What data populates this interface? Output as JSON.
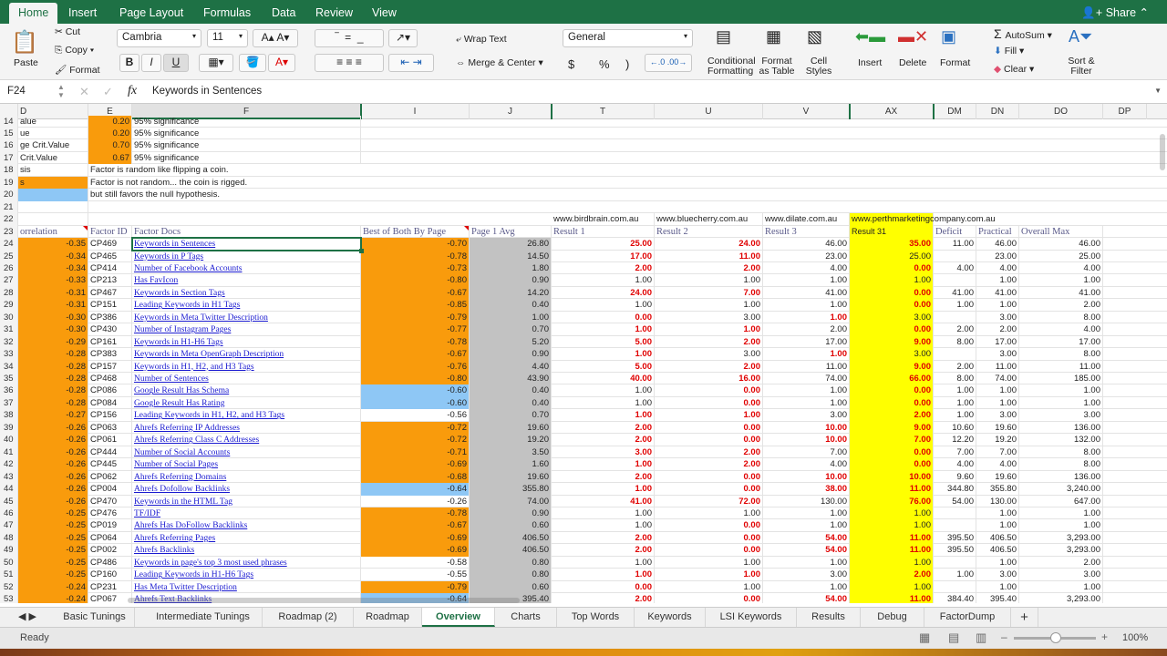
{
  "ribbon_tabs": [
    "Home",
    "Insert",
    "Page Layout",
    "Formulas",
    "Data",
    "Review",
    "View"
  ],
  "share_label": "Share",
  "ribbon": {
    "paste": "Paste",
    "cut": "Cut",
    "copy": "Copy",
    "format_painter": "Format",
    "font": "Cambria",
    "font_size": "11",
    "bold": "B",
    "italic": "I",
    "underline": "U",
    "wrap_text": "Wrap Text",
    "merge_center": "Merge & Center",
    "number_format": "General",
    "currency": "$",
    "percent": "%",
    "comma": ")",
    "conditional_formatting": "Conditional Formatting",
    "format_as_table": "Format as Table",
    "cell_styles": "Cell Styles",
    "insert": "Insert",
    "delete": "Delete",
    "format": "Format",
    "autosum": "AutoSum",
    "fill": "Fill",
    "clear": "Clear",
    "sort_filter": "Sort & Filter"
  },
  "formula_bar": {
    "name_box": "F24",
    "fx": "fx",
    "content": "Keywords in Sentences"
  },
  "columns": [
    "D",
    "E",
    "F",
    "I",
    "J",
    "T",
    "U",
    "V",
    "AX",
    "DM",
    "DN",
    "DO",
    "DP"
  ],
  "top_rows": [
    {
      "n": "14",
      "d": "alue",
      "e": "0.20",
      "f": "95% significance"
    },
    {
      "n": "15",
      "d": "ue",
      "e": "0.20",
      "f": "95% significance"
    },
    {
      "n": "16",
      "d": "ge Crit.Value",
      "e": "0.70",
      "f": "95% significance"
    },
    {
      "n": "17",
      "d": "Crit.Value",
      "e": "0.67",
      "f": "95% significance"
    },
    {
      "n": "18",
      "d": "sis",
      "note": "Factor is random like flipping a coin."
    },
    {
      "n": "19",
      "d": "s",
      "note": "Factor is not random... the coin is rigged."
    },
    {
      "n": "20",
      "d": "",
      "note": "but still favors the null hypothesis."
    },
    {
      "n": "21"
    },
    {
      "n": "22",
      "sites": [
        "www.birdbrain.com.au",
        "www.bluecherry.com.au",
        "www.dilate.com.au",
        "www.perthmarketingcompany.com.au"
      ]
    }
  ],
  "headers": {
    "n": "23",
    "d": "orrelation",
    "e": "Factor ID",
    "f": "Factor Docs",
    "i": "Best of Both By Page",
    "j": "Page 1 Avg",
    "t": "Result 1",
    "u": "Result 2",
    "v": "Result 3",
    "ax": "Result 31",
    "dm": "Deficit",
    "dn": "Practical",
    "do": "Overall Max"
  },
  "colors": {
    "orange": "#f99b0c",
    "blue": "#8ec7f5",
    "gray": "#c2c2c2",
    "yellow": "#ffff00",
    "red_text": "#e00000",
    "excel_green": "#1e7145"
  },
  "rows": [
    {
      "n": "24",
      "d": "-0.35",
      "e": "CP469",
      "f": "Keywords in Sentences",
      "i": "-0.70",
      "ic": "or",
      "j": "26.80",
      "t": "25.00",
      "u": "24.00",
      "v": "46.00",
      "ax": "35.00",
      "dm": "11.00",
      "dn": "46.00",
      "do": "46.00",
      "red": [
        "t",
        "u",
        "ax"
      ]
    },
    {
      "n": "25",
      "d": "-0.34",
      "e": "CP465",
      "f": "Keywords in P Tags",
      "i": "-0.78",
      "ic": "or",
      "j": "14.50",
      "t": "17.00",
      "u": "11.00",
      "v": "23.00",
      "ax": "25.00",
      "dm": "",
      "dn": "23.00",
      "do": "25.00",
      "red": [
        "t",
        "u"
      ]
    },
    {
      "n": "26",
      "d": "-0.34",
      "e": "CP414",
      "f": "Number of Facebook Accounts",
      "i": "-0.73",
      "ic": "or",
      "j": "1.80",
      "t": "2.00",
      "u": "2.00",
      "v": "4.00",
      "ax": "0.00",
      "dm": "4.00",
      "dn": "4.00",
      "do": "4.00",
      "red": [
        "t",
        "u",
        "ax"
      ]
    },
    {
      "n": "27",
      "d": "-0.33",
      "e": "CP213",
      "f": "Has FavIcon",
      "i": "-0.80",
      "ic": "or",
      "j": "0.90",
      "t": "1.00",
      "u": "1.00",
      "v": "1.00",
      "ax": "1.00",
      "dm": "",
      "dn": "1.00",
      "do": "1.00",
      "red": []
    },
    {
      "n": "28",
      "d": "-0.31",
      "e": "CP467",
      "f": "Keywords in Section Tags",
      "i": "-0.67",
      "ic": "or",
      "j": "14.20",
      "t": "24.00",
      "u": "7.00",
      "v": "41.00",
      "ax": "0.00",
      "dm": "41.00",
      "dn": "41.00",
      "do": "41.00",
      "red": [
        "t",
        "u",
        "ax"
      ]
    },
    {
      "n": "29",
      "d": "-0.31",
      "e": "CP151",
      "f": "Leading Keywords in H1 Tags",
      "i": "-0.85",
      "ic": "or",
      "j": "0.40",
      "t": "1.00",
      "u": "1.00",
      "v": "1.00",
      "ax": "0.00",
      "dm": "1.00",
      "dn": "1.00",
      "do": "2.00",
      "red": [
        "ax"
      ]
    },
    {
      "n": "30",
      "d": "-0.30",
      "e": "CP386",
      "f": "Keywords in Meta Twitter Description",
      "i": "-0.79",
      "ic": "or",
      "j": "1.00",
      "t": "0.00",
      "u": "3.00",
      "v": "1.00",
      "ax": "3.00",
      "dm": "",
      "dn": "3.00",
      "do": "8.00",
      "red": [
        "t",
        "v"
      ]
    },
    {
      "n": "31",
      "d": "-0.30",
      "e": "CP430",
      "f": "Number of Instagram Pages",
      "i": "-0.77",
      "ic": "or",
      "j": "0.70",
      "t": "1.00",
      "u": "1.00",
      "v": "2.00",
      "ax": "0.00",
      "dm": "2.00",
      "dn": "2.00",
      "do": "4.00",
      "red": [
        "t",
        "u",
        "ax"
      ]
    },
    {
      "n": "32",
      "d": "-0.29",
      "e": "CP161",
      "f": "Keywords in H1-H6 Tags",
      "i": "-0.78",
      "ic": "or",
      "j": "5.20",
      "t": "5.00",
      "u": "2.00",
      "v": "17.00",
      "ax": "9.00",
      "dm": "8.00",
      "dn": "17.00",
      "do": "17.00",
      "red": [
        "t",
        "u",
        "ax"
      ]
    },
    {
      "n": "33",
      "d": "-0.28",
      "e": "CP383",
      "f": "Keywords in Meta OpenGraph Description",
      "i": "-0.67",
      "ic": "or",
      "j": "0.90",
      "t": "1.00",
      "u": "3.00",
      "v": "1.00",
      "ax": "3.00",
      "dm": "",
      "dn": "3.00",
      "do": "8.00",
      "red": [
        "t",
        "v"
      ]
    },
    {
      "n": "34",
      "d": "-0.28",
      "e": "CP157",
      "f": "Keywords in H1, H2, and H3 Tags",
      "i": "-0.76",
      "ic": "or",
      "j": "4.40",
      "t": "5.00",
      "u": "2.00",
      "v": "11.00",
      "ax": "9.00",
      "dm": "2.00",
      "dn": "11.00",
      "do": "11.00",
      "red": [
        "t",
        "u",
        "ax"
      ]
    },
    {
      "n": "35",
      "d": "-0.28",
      "e": "CP468",
      "f": "Number of Sentences",
      "i": "-0.80",
      "ic": "or",
      "j": "43.90",
      "t": "40.00",
      "u": "16.00",
      "v": "74.00",
      "ax": "66.00",
      "dm": "8.00",
      "dn": "74.00",
      "do": "185.00",
      "red": [
        "t",
        "u",
        "ax"
      ]
    },
    {
      "n": "36",
      "d": "-0.28",
      "e": "CP086",
      "f": "Google Result Has Schema",
      "i": "-0.60",
      "ic": "bl",
      "j": "0.40",
      "t": "1.00",
      "u": "0.00",
      "v": "1.00",
      "ax": "0.00",
      "dm": "1.00",
      "dn": "1.00",
      "do": "1.00",
      "red": [
        "u",
        "ax"
      ]
    },
    {
      "n": "37",
      "d": "-0.28",
      "e": "CP084",
      "f": "Google Result Has Rating",
      "i": "-0.60",
      "ic": "bl",
      "j": "0.40",
      "t": "1.00",
      "u": "0.00",
      "v": "1.00",
      "ax": "0.00",
      "dm": "1.00",
      "dn": "1.00",
      "do": "1.00",
      "red": [
        "u",
        "ax"
      ]
    },
    {
      "n": "38",
      "d": "-0.27",
      "e": "CP156",
      "f": "Leading Keywords in H1, H2, and H3 Tags",
      "i": "-0.56",
      "ic": "",
      "j": "0.70",
      "t": "1.00",
      "u": "1.00",
      "v": "3.00",
      "ax": "2.00",
      "dm": "1.00",
      "dn": "3.00",
      "do": "3.00",
      "red": [
        "t",
        "u",
        "ax"
      ]
    },
    {
      "n": "39",
      "d": "-0.26",
      "e": "CP063",
      "f": "Ahrefs Referring IP Addresses",
      "i": "-0.72",
      "ic": "or",
      "j": "19.60",
      "t": "2.00",
      "u": "0.00",
      "v": "10.00",
      "ax": "9.00",
      "dm": "10.60",
      "dn": "19.60",
      "do": "136.00",
      "red": [
        "t",
        "u",
        "v",
        "ax"
      ]
    },
    {
      "n": "40",
      "d": "-0.26",
      "e": "CP061",
      "f": "Ahrefs Referring Class C Addresses",
      "i": "-0.72",
      "ic": "or",
      "j": "19.20",
      "t": "2.00",
      "u": "0.00",
      "v": "10.00",
      "ax": "7.00",
      "dm": "12.20",
      "dn": "19.20",
      "do": "132.00",
      "red": [
        "t",
        "u",
        "v",
        "ax"
      ]
    },
    {
      "n": "41",
      "d": "-0.26",
      "e": "CP444",
      "f": "Number of Social Accounts",
      "i": "-0.71",
      "ic": "or",
      "j": "3.50",
      "t": "3.00",
      "u": "2.00",
      "v": "7.00",
      "ax": "0.00",
      "dm": "7.00",
      "dn": "7.00",
      "do": "8.00",
      "red": [
        "t",
        "u",
        "ax"
      ]
    },
    {
      "n": "42",
      "d": "-0.26",
      "e": "CP445",
      "f": "Number of Social Pages",
      "i": "-0.69",
      "ic": "or",
      "j": "1.60",
      "t": "1.00",
      "u": "2.00",
      "v": "4.00",
      "ax": "0.00",
      "dm": "4.00",
      "dn": "4.00",
      "do": "8.00",
      "red": [
        "t",
        "u",
        "ax"
      ]
    },
    {
      "n": "43",
      "d": "-0.26",
      "e": "CP062",
      "f": "Ahrefs Referring Domains",
      "i": "-0.68",
      "ic": "or",
      "j": "19.60",
      "t": "2.00",
      "u": "0.00",
      "v": "10.00",
      "ax": "10.00",
      "dm": "9.60",
      "dn": "19.60",
      "do": "136.00",
      "red": [
        "t",
        "u",
        "v",
        "ax"
      ]
    },
    {
      "n": "44",
      "d": "-0.26",
      "e": "CP004",
      "f": "Ahrefs Dofollow Backlinks",
      "i": "-0.64",
      "ic": "bl",
      "j": "355.80",
      "t": "1.00",
      "u": "0.00",
      "v": "38.00",
      "ax": "11.00",
      "dm": "344.80",
      "dn": "355.80",
      "do": "3,240.00",
      "red": [
        "t",
        "u",
        "v",
        "ax"
      ]
    },
    {
      "n": "45",
      "d": "-0.26",
      "e": "CP470",
      "f": "Keywords in the HTML Tag",
      "i": "-0.26",
      "ic": "",
      "j": "74.00",
      "t": "41.00",
      "u": "72.00",
      "v": "130.00",
      "ax": "76.00",
      "dm": "54.00",
      "dn": "130.00",
      "do": "647.00",
      "red": [
        "t",
        "u",
        "ax"
      ]
    },
    {
      "n": "46",
      "d": "-0.25",
      "e": "CP476",
      "f": "TF/IDF",
      "i": "-0.78",
      "ic": "or",
      "j": "0.90",
      "t": "1.00",
      "u": "1.00",
      "v": "1.00",
      "ax": "1.00",
      "dm": "",
      "dn": "1.00",
      "do": "1.00",
      "red": []
    },
    {
      "n": "47",
      "d": "-0.25",
      "e": "CP019",
      "f": "Ahrefs Has DoFollow Backlinks",
      "i": "-0.67",
      "ic": "or",
      "j": "0.60",
      "t": "1.00",
      "u": "0.00",
      "v": "1.00",
      "ax": "1.00",
      "dm": "",
      "dn": "1.00",
      "do": "1.00",
      "red": [
        "u"
      ]
    },
    {
      "n": "48",
      "d": "-0.25",
      "e": "CP064",
      "f": "Ahrefs Referring Pages",
      "i": "-0.69",
      "ic": "or",
      "j": "406.50",
      "t": "2.00",
      "u": "0.00",
      "v": "54.00",
      "ax": "11.00",
      "dm": "395.50",
      "dn": "406.50",
      "do": "3,293.00",
      "red": [
        "t",
        "u",
        "v",
        "ax"
      ]
    },
    {
      "n": "49",
      "d": "-0.25",
      "e": "CP002",
      "f": "Ahrefs Backlinks",
      "i": "-0.69",
      "ic": "or",
      "j": "406.50",
      "t": "2.00",
      "u": "0.00",
      "v": "54.00",
      "ax": "11.00",
      "dm": "395.50",
      "dn": "406.50",
      "do": "3,293.00",
      "red": [
        "t",
        "u",
        "v",
        "ax"
      ]
    },
    {
      "n": "50",
      "d": "-0.25",
      "e": "CP486",
      "f": "Keywords in page's top 3 most used phrases",
      "i": "-0.58",
      "ic": "",
      "j": "0.80",
      "t": "1.00",
      "u": "1.00",
      "v": "1.00",
      "ax": "1.00",
      "dm": "",
      "dn": "1.00",
      "do": "2.00",
      "red": []
    },
    {
      "n": "51",
      "d": "-0.25",
      "e": "CP160",
      "f": "Leading Keywords in H1-H6 Tags",
      "i": "-0.55",
      "ic": "",
      "j": "0.80",
      "t": "1.00",
      "u": "1.00",
      "v": "3.00",
      "ax": "2.00",
      "dm": "1.00",
      "dn": "3.00",
      "do": "3.00",
      "red": [
        "t",
        "u",
        "ax"
      ]
    },
    {
      "n": "52",
      "d": "-0.24",
      "e": "CP231",
      "f": "Has Meta Twitter Description",
      "i": "-0.79",
      "ic": "or",
      "j": "0.60",
      "t": "0.00",
      "u": "1.00",
      "v": "1.00",
      "ax": "1.00",
      "dm": "",
      "dn": "1.00",
      "do": "1.00",
      "red": [
        "t"
      ]
    },
    {
      "n": "53",
      "d": "-0.24",
      "e": "CP067",
      "f": "Ahrefs Text Backlinks",
      "i": "-0.64",
      "ic": "bl",
      "j": "395.40",
      "t": "2.00",
      "u": "0.00",
      "v": "54.00",
      "ax": "11.00",
      "dm": "384.40",
      "dn": "395.40",
      "do": "3,293.00",
      "red": [
        "t",
        "u",
        "v",
        "ax"
      ]
    }
  ],
  "sheet_tabs": [
    "Basic Tunings",
    "Intermediate Tunings",
    "Roadmap (2)",
    "Roadmap",
    "Overview",
    "Charts",
    "Top Words",
    "Keywords",
    "LSI Keywords",
    "Results",
    "Debug",
    "FactorDump"
  ],
  "active_sheet": "Overview",
  "status": {
    "text": "Ready",
    "zoom": "100%",
    "zoom_level_percent": 100
  }
}
